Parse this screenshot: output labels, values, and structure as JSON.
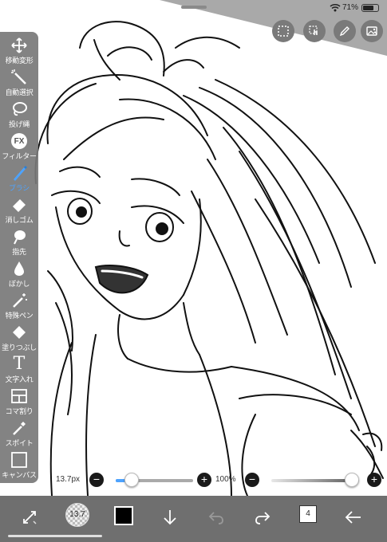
{
  "status": {
    "battery": "71%"
  },
  "toolbar": {
    "tools": [
      {
        "label": "移動変形",
        "icon": "move-icon"
      },
      {
        "label": "自動選択",
        "icon": "magic-wand-icon"
      },
      {
        "label": "投げ縄",
        "icon": "lasso-icon"
      },
      {
        "label": "フィルター",
        "icon": "fx-icon",
        "icon_text": "FX"
      },
      {
        "label": "ブラシ",
        "icon": "brush-icon",
        "active": true
      },
      {
        "label": "消しゴム",
        "icon": "eraser-icon"
      },
      {
        "label": "指先",
        "icon": "smudge-icon"
      },
      {
        "label": "ぼかし",
        "icon": "blur-icon"
      },
      {
        "label": "特殊ペン",
        "icon": "special-pen-icon"
      },
      {
        "label": "塗りつぶし",
        "icon": "fill-icon"
      },
      {
        "label": "文字入れ",
        "icon": "text-icon",
        "icon_text": "T"
      },
      {
        "label": "コマ割り",
        "icon": "frame-divider-icon"
      },
      {
        "label": "スポイト",
        "icon": "eyedropper-icon"
      },
      {
        "label": "キャンバス",
        "icon": "canvas-icon"
      }
    ]
  },
  "top_buttons": [
    "selection-icon",
    "touch-icon",
    "pen-icon",
    "image-icon"
  ],
  "sliders": {
    "brush_size": {
      "text": "13.7px",
      "level": 0.12
    },
    "opacity": {
      "text": "100%",
      "level": 1.0
    },
    "minus": "−",
    "plus": "+"
  },
  "bottom_bar": {
    "brush_size_text": "13.7",
    "color": "#000000",
    "layer_count": "4"
  },
  "colors": {
    "toolbar_bg": "#787878",
    "active_tool": "#4da3ff",
    "bottom_bar_bg": "#6f6f6f"
  }
}
